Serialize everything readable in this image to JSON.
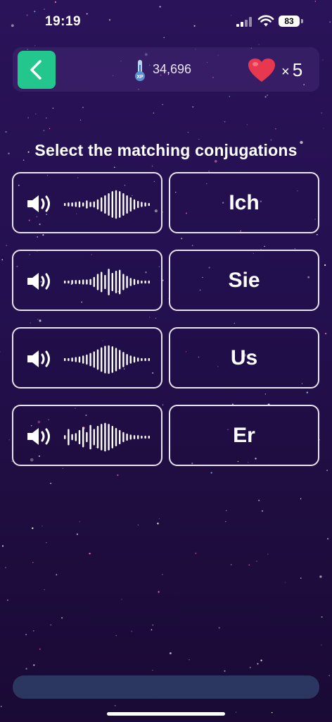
{
  "status": {
    "time": "19:19",
    "battery": "83"
  },
  "header": {
    "xp": "34,696",
    "lives_prefix": "×",
    "lives": "5"
  },
  "prompt": "Select the matching conjugations",
  "words": [
    "Ich",
    "Sie",
    "Us",
    "Er"
  ],
  "colors": {
    "accent": "#23c68c",
    "background": "#241050",
    "heart": "#e8384f"
  }
}
